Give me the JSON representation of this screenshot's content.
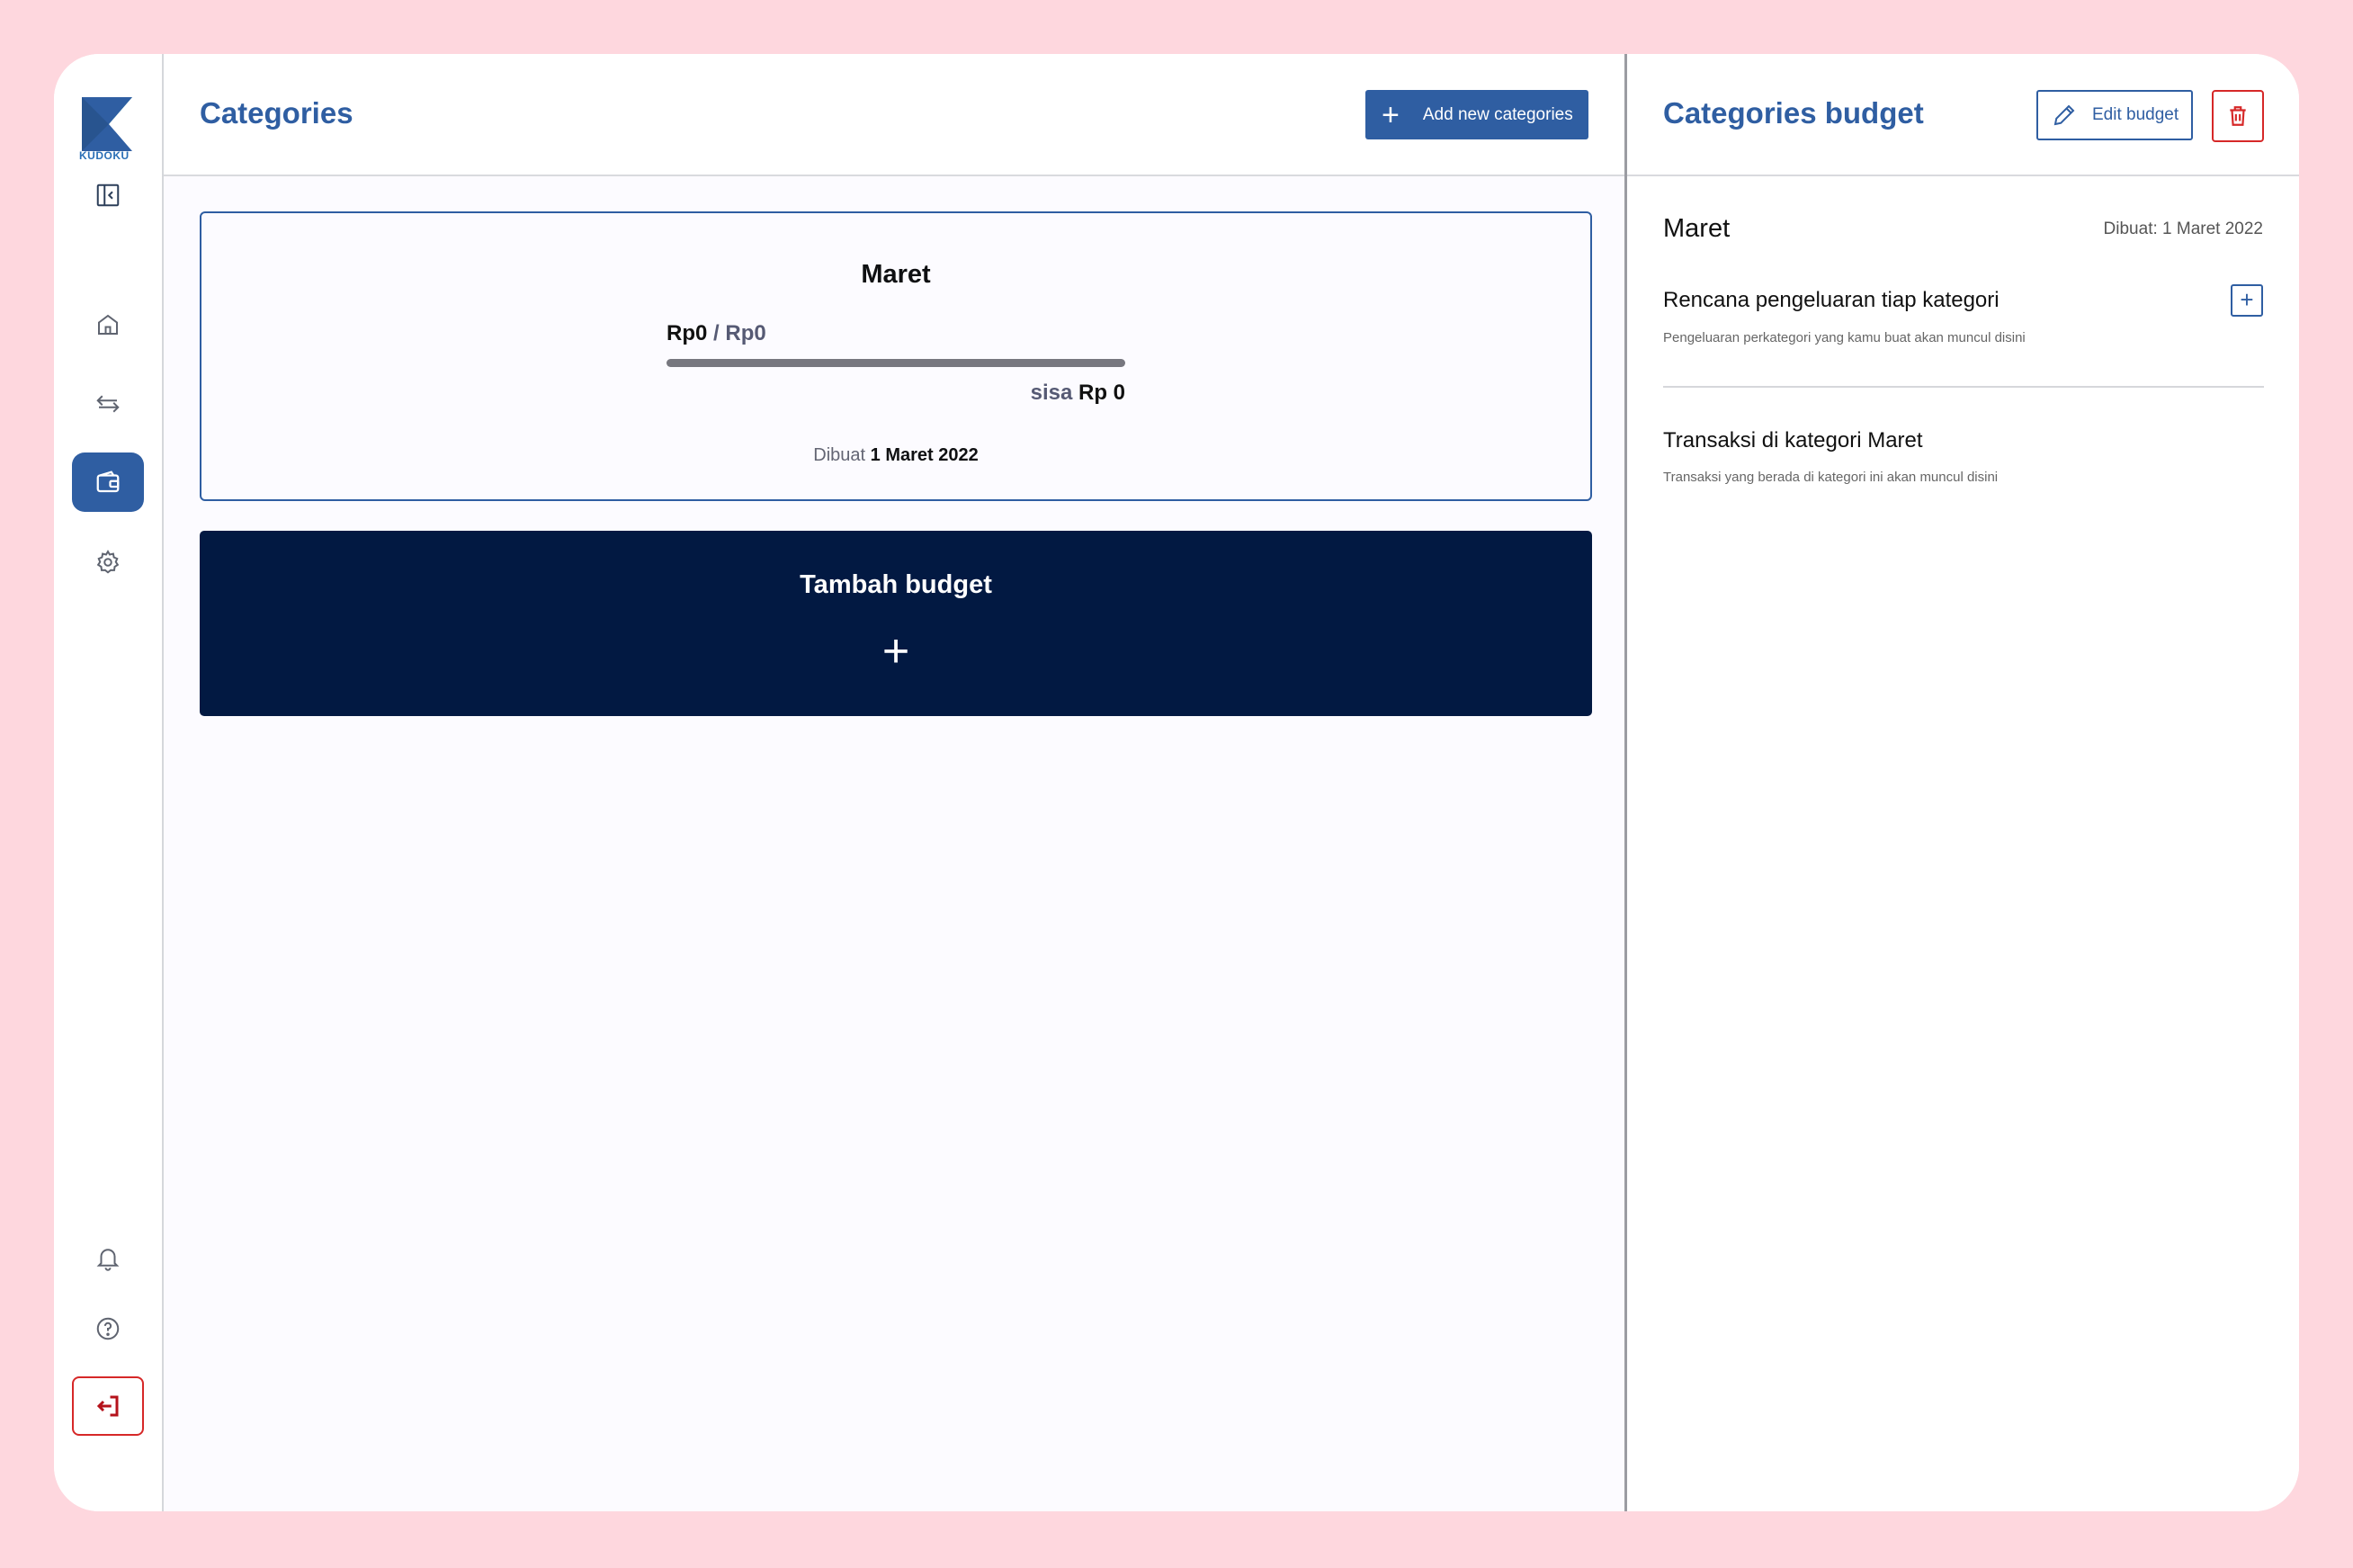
{
  "sidebar": {
    "logo_text": "KUDOKU",
    "icons": [
      "collapse-sidebar-icon",
      "home-icon",
      "transfer-icon",
      "wallet-icon",
      "settings-icon",
      "bell-icon",
      "help-icon",
      "logout-icon"
    ],
    "active": "wallet-icon"
  },
  "main": {
    "title": "Categories",
    "add_button_label": "Add new categories",
    "budget_card": {
      "month": "Maret",
      "spent": "Rp0",
      "separator": "/",
      "total": "Rp0",
      "progress": 0,
      "remaining_label": "sisa",
      "remaining_value": "Rp 0",
      "created_label": "Dibuat",
      "created_date": "1 Maret 2022"
    },
    "add_budget_label": "Tambah budget"
  },
  "detail": {
    "title": "Categories budget",
    "edit_button_label": "Edit budget",
    "month": "Maret",
    "created": "Dibuat: 1 Maret 2022",
    "plan_title": "Rencana pengeluaran tiap kategori",
    "plan_subtitle": "Pengeluaran perkategori yang kamu buat akan muncul disini",
    "transactions_title": "Transaksi di kategori Maret",
    "transactions_subtitle": "Transaksi yang berada di kategori ini akan muncul disini"
  },
  "colors": {
    "background": "#fed7de",
    "primary": "#2f5ea2",
    "dark_navy": "#021942",
    "danger": "#d62828"
  }
}
